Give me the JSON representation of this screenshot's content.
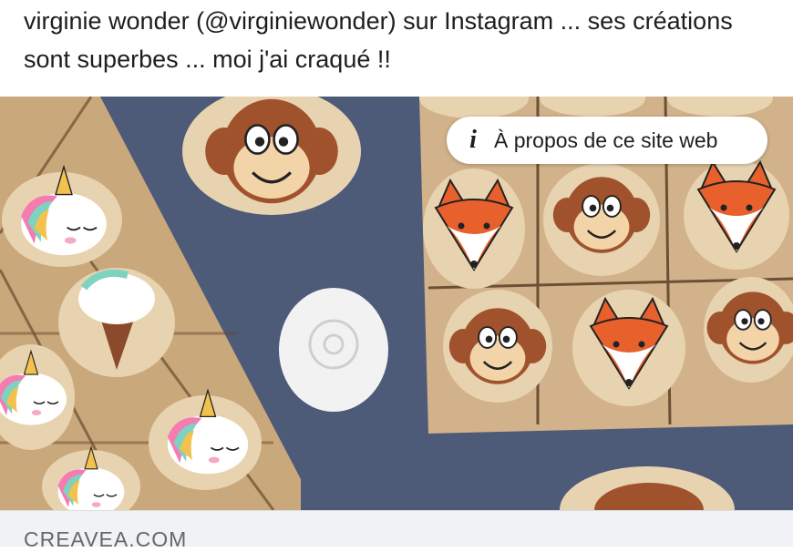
{
  "post": {
    "text": "virginie wonder (@virginiewonder) sur Instagram ... ses créations sont superbes ... moi j'ai craqué !!"
  },
  "media": {
    "about_button_label": "À propos de ce site web",
    "about_icon": "info-icon",
    "colors": {
      "background_slate": "#4d5a78",
      "burlap": "#c9a87c",
      "stone": "#e8d3b0",
      "monkey": "#a0522d",
      "fox": "#e8602c"
    }
  },
  "link_preview": {
    "domain": "CREAVEA.COM"
  }
}
